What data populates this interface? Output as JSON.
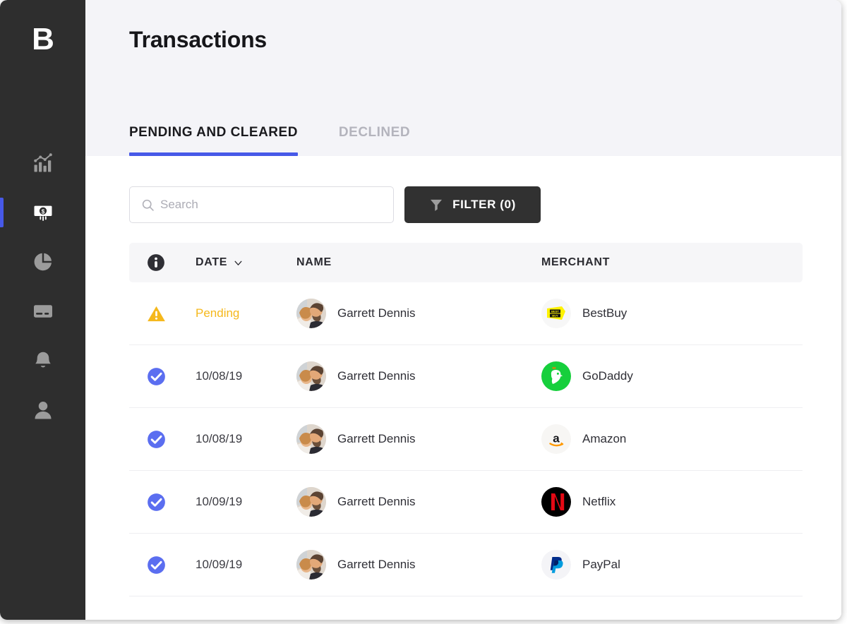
{
  "app": {
    "logo_letter": "B",
    "accent_color": "#4759e8",
    "sidebar_bg": "#2e2e2e",
    "pending_color": "#f5b81c"
  },
  "sidebar": {
    "items": [
      {
        "name": "analytics",
        "icon": "bar-chart-icon",
        "active": false
      },
      {
        "name": "transactions",
        "icon": "money-icon",
        "active": true
      },
      {
        "name": "reports",
        "icon": "pie-chart-icon",
        "active": false
      },
      {
        "name": "cards",
        "icon": "credit-card-icon",
        "active": false
      },
      {
        "name": "notifications",
        "icon": "bell-icon",
        "active": false
      },
      {
        "name": "profile",
        "icon": "person-icon",
        "active": false
      }
    ]
  },
  "header": {
    "title": "Transactions"
  },
  "tabs": [
    {
      "label": "PENDING AND CLEARED",
      "active": true
    },
    {
      "label": "DECLINED",
      "active": false
    }
  ],
  "toolbar": {
    "search": {
      "placeholder": "Search",
      "value": "",
      "icon": "search-icon"
    },
    "filter": {
      "label": "FILTER (0)",
      "count": 0,
      "icon": "funnel-icon"
    }
  },
  "table": {
    "columns": {
      "status_icon": "info-icon",
      "date": "DATE",
      "name": "NAME",
      "merchant": "MERCHANT"
    },
    "sort": {
      "column": "DATE",
      "icon": "chevron-down-icon"
    },
    "rows": [
      {
        "status": "pending",
        "status_icon": "warning-triangle-icon",
        "date": "Pending",
        "name": "Garrett Dennis",
        "avatar": "user-photo-avatar",
        "merchant": "BestBuy",
        "merchant_logo": "bestbuy-logo"
      },
      {
        "status": "cleared",
        "status_icon": "check-circle-icon",
        "date": "10/08/19",
        "name": "Garrett Dennis",
        "avatar": "user-photo-avatar",
        "merchant": "GoDaddy",
        "merchant_logo": "godaddy-logo"
      },
      {
        "status": "cleared",
        "status_icon": "check-circle-icon",
        "date": "10/08/19",
        "name": "Garrett Dennis",
        "avatar": "user-photo-avatar",
        "merchant": "Amazon",
        "merchant_logo": "amazon-logo"
      },
      {
        "status": "cleared",
        "status_icon": "check-circle-icon",
        "date": "10/09/19",
        "name": "Garrett Dennis",
        "avatar": "user-photo-avatar",
        "merchant": "Netflix",
        "merchant_logo": "netflix-logo"
      },
      {
        "status": "cleared",
        "status_icon": "check-circle-icon",
        "date": "10/09/19",
        "name": "Garrett Dennis",
        "avatar": "user-photo-avatar",
        "merchant": "PayPal",
        "merchant_logo": "paypal-logo"
      }
    ]
  }
}
